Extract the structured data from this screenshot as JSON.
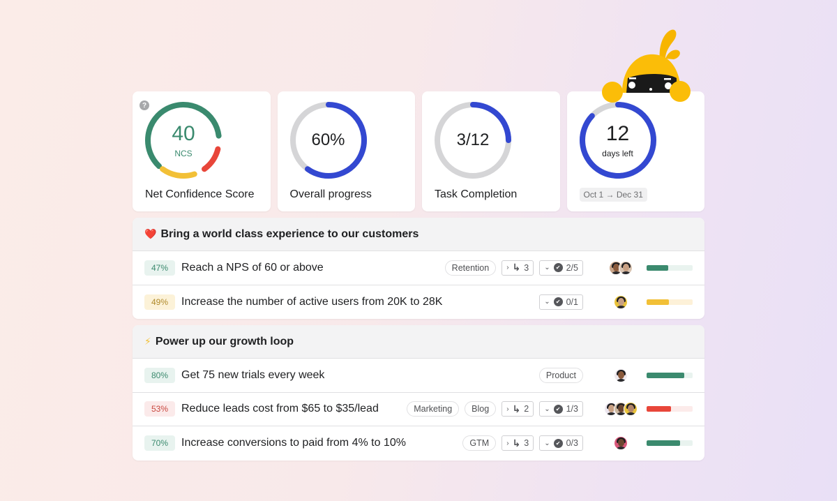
{
  "cards": [
    {
      "kind": "ncs",
      "value": "40",
      "sub": "NCS",
      "label": "Net Confidence Score",
      "help_icon": "question-icon",
      "segments": {
        "green": 0.56,
        "red": 0.12,
        "yellow": 0.22
      },
      "colors": {
        "green": "#3a8a6e",
        "red": "#e8463a",
        "yellow": "#f2c037",
        "text": "#3a8a6e"
      }
    },
    {
      "kind": "progress",
      "value": "60%",
      "label": "Overall progress",
      "fraction": 0.6
    },
    {
      "kind": "progress",
      "value": "3/12",
      "label": "Task Completion",
      "fraction": 0.25
    },
    {
      "kind": "days",
      "value": "12",
      "sub": "days left",
      "fraction": 0.87,
      "date_range": "Oct 1 → Dec 31"
    }
  ],
  "colors": {
    "ring_track": "#d5d5d7",
    "ring_fill": "#3348d1",
    "green": "#3b8a6e",
    "yellow": "#f2c037",
    "red": "#e8463a"
  },
  "groups": [
    {
      "emoji": "❤️",
      "icon": "heart-icon",
      "title": "Bring a world class experience to our customers",
      "rows": [
        {
          "pct": "47%",
          "tone": "green",
          "title": "Reach a NPS of 60 or above",
          "tags": [
            "Retention"
          ],
          "subgoals": "3",
          "tasks": "2/5",
          "avatars": [
            "#c9a58a",
            "#d9c4b2"
          ],
          "progress": 0.47
        },
        {
          "pct": "49%",
          "tone": "yellow",
          "title": "Increase the number of active users from 20K to 28K",
          "tags": [],
          "subgoals": null,
          "tasks": "0/1",
          "avatars": [
            "#e8c23a"
          ],
          "progress": 0.49
        }
      ]
    },
    {
      "emoji": "⚡",
      "icon": "lightning-icon",
      "title": "Power up our growth loop",
      "rows": [
        {
          "pct": "80%",
          "tone": "green",
          "title": "Get 75 new trials every week",
          "tags": [
            "Product"
          ],
          "subgoals": null,
          "tasks": null,
          "avatars": [
            "#efe9ee"
          ],
          "progress": 0.82
        },
        {
          "pct": "53%",
          "tone": "red",
          "title": "Reduce leads cost from $65 to $35/lead",
          "tags": [
            "Marketing",
            "Blog"
          ],
          "subgoals": "2",
          "tasks": "1/3",
          "avatars": [
            "#ece6ef",
            "#cdb9a3",
            "#e8c23a"
          ],
          "progress": 0.53
        },
        {
          "pct": "70%",
          "tone": "green",
          "title": "Increase conversions to paid from 4% to 10%",
          "tags": [
            "GTM"
          ],
          "subgoals": "3",
          "tasks": "0/3",
          "avatars": [
            "#d9577a"
          ],
          "progress": 0.72
        }
      ]
    }
  ]
}
